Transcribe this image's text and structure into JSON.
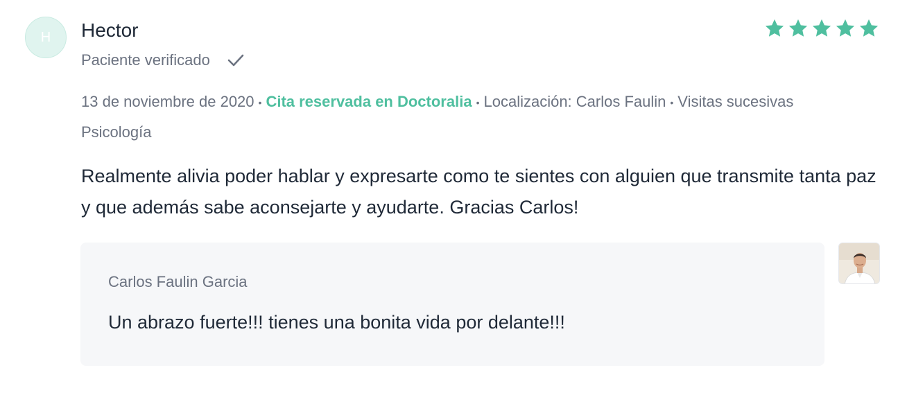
{
  "reviewer": {
    "initial": "H",
    "name": "Hector",
    "status": "Paciente verificado"
  },
  "rating": {
    "stars": 5,
    "max": 5,
    "color": "#4fbf9f"
  },
  "meta": {
    "date": "13 de noviembre de 2020",
    "booking": "Cita reservada en Doctoralia",
    "location": "Localización: Carlos Faulin",
    "visit_type": "Visitas sucesivas",
    "separator": "•",
    "service": "Psicología"
  },
  "review": {
    "text": "Realmente alivia poder hablar y expresarte como te sientes con alguien que transmite tanta paz y que además sabe aconsejarte y ayudarte. Gracias Carlos!"
  },
  "reply": {
    "author": "Carlos Faulin Garcia",
    "text": "Un abrazo fuerte!!! tienes una bonita vida por delante!!!"
  },
  "icons": {
    "verified": "check-icon",
    "rating": "star-icon",
    "doctor": "doctor-photo"
  },
  "colors": {
    "accent": "#4fbf9f",
    "muted_text": "#6b7280",
    "reply_background": "#f6f7f9"
  }
}
